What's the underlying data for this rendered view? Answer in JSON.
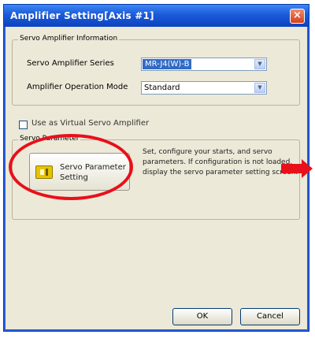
{
  "dialog": {
    "title": "Amplifier Setting[Axis #1]",
    "close_symbol": "×"
  },
  "amp_info": {
    "group_title": "Servo Amplifier Information",
    "series_label": "Servo Amplifier Series",
    "series_value": "MR-J4(W)-B",
    "mode_label": "Amplifier Operation Mode",
    "mode_value": "Standard"
  },
  "virtual": {
    "label": "Use as Virtual Servo Amplifier",
    "checked": false
  },
  "servo_param": {
    "group_title": "Servo Parameter",
    "button_label": "Servo Parameter Setting",
    "description": "Set, configure your starts, and servo parameters. If configuration is not loaded, display the servo parameter setting screen."
  },
  "footer": {
    "ok_label": "OK",
    "cancel_label": "Cancel"
  },
  "icons": {
    "close": "close-icon",
    "combo_arrow": "chevron-down-icon",
    "servo": "servo-amplifier-icon"
  },
  "colors": {
    "titlebar": "#1a5ad9",
    "highlight": "#e8101a",
    "selection": "#316ac5"
  }
}
